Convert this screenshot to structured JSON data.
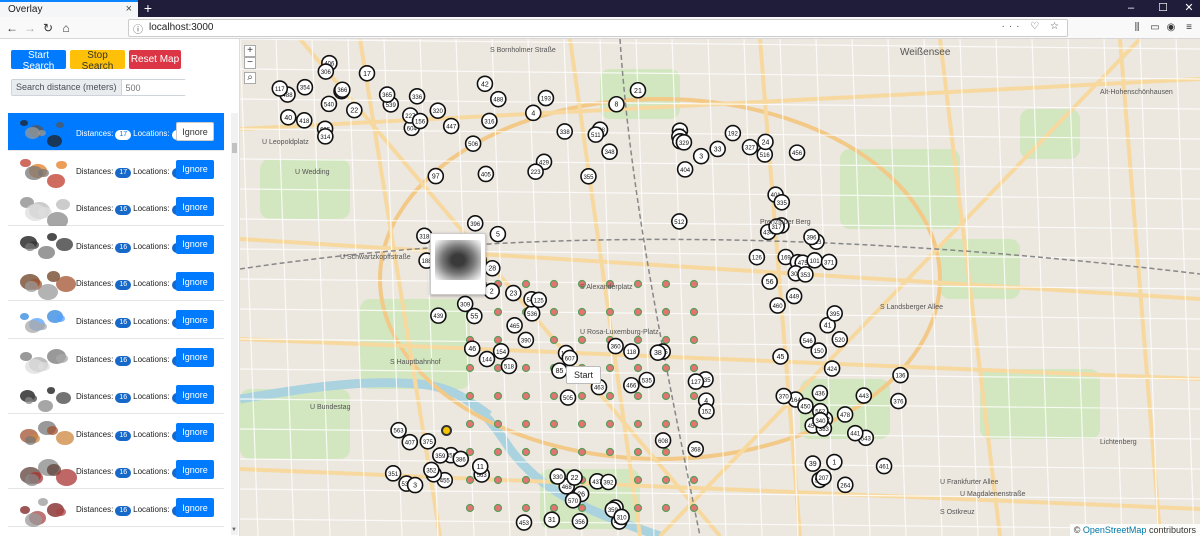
{
  "browser": {
    "tab_title": "Overlay",
    "url": "localhost:3000"
  },
  "controls": {
    "start_label": "Start Search",
    "stop_label": "Stop Search",
    "reset_label": "Reset Map",
    "distance_label": "Search distance (meters)",
    "distance_placeholder": "500"
  },
  "results": [
    {
      "distances": "17",
      "locations": "1",
      "ignore_label": "Ignore",
      "active": true
    },
    {
      "distances": "17",
      "locations": "2",
      "ignore_label": "Ignore"
    },
    {
      "distances": "16",
      "locations": "3",
      "ignore_label": "Ignore"
    },
    {
      "distances": "16",
      "locations": "3",
      "ignore_label": "Ignore"
    },
    {
      "distances": "16",
      "locations": "3",
      "ignore_label": "Ignore"
    },
    {
      "distances": "16",
      "locations": "3",
      "ignore_label": "Ignore"
    },
    {
      "distances": "16",
      "locations": "3",
      "ignore_label": "Ignore"
    },
    {
      "distances": "16",
      "locations": "3",
      "ignore_label": "Ignore"
    },
    {
      "distances": "16",
      "locations": "3",
      "ignore_label": "Ignore"
    },
    {
      "distances": "16",
      "locations": "3",
      "ignore_label": "Ignore"
    },
    {
      "distances": "16",
      "locations": "3",
      "ignore_label": "Ignore"
    }
  ],
  "row_labels": {
    "distances": "Distances:",
    "locations": "Locations:"
  },
  "map": {
    "start_label": "Start",
    "attribution_prefix": "©",
    "attribution_link": "OpenStreetMap",
    "attribution_suffix": "contributors",
    "place_names": [
      "Weißensee",
      "Alt-Hohenschönhausen",
      "U Leopoldplatz",
      "U Wedding",
      "S Bornholmer Straße",
      "U Schwartzkopffstraße",
      "S Hauptbahnhof",
      "U Bundestag",
      "S Alexanderplatz",
      "U Rosa-Luxemburg-Platz",
      "Prenzlauer Berg",
      "Lichtenberg",
      "U Frankfurter Allee",
      "S Landsberger Allee",
      "U Magdalenenstraße",
      "S Ostkreuz"
    ],
    "markers": [
      {
        "n": "540"
      },
      {
        "n": "539"
      },
      {
        "n": "528"
      },
      {
        "n": "512"
      },
      {
        "n": "454"
      },
      {
        "n": "518"
      },
      {
        "n": "535"
      },
      {
        "n": "520"
      },
      {
        "n": "513"
      },
      {
        "n": "543"
      },
      {
        "n": "563"
      },
      {
        "n": "490"
      },
      {
        "n": "488"
      },
      {
        "n": "488"
      },
      {
        "n": "511"
      },
      {
        "n": "516"
      },
      {
        "n": "439"
      },
      {
        "n": "536"
      },
      {
        "n": "535"
      },
      {
        "n": "164"
      },
      {
        "n": "169"
      },
      {
        "n": "505"
      },
      {
        "n": "530"
      },
      {
        "n": "468"
      },
      {
        "n": "398"
      },
      {
        "n": "506"
      },
      {
        "n": "193"
      },
      {
        "n": "192"
      },
      {
        "n": "188"
      },
      {
        "n": "184"
      },
      {
        "n": "435"
      },
      {
        "n": "424"
      },
      {
        "n": "449"
      },
      {
        "n": "441"
      },
      {
        "n": "407"
      },
      {
        "n": "437"
      },
      {
        "n": "418"
      },
      {
        "n": "405"
      },
      {
        "n": "404"
      },
      {
        "n": "401"
      },
      {
        "n": "396"
      },
      {
        "n": "465"
      },
      {
        "n": "463"
      },
      {
        "n": "443"
      },
      {
        "n": "460"
      },
      {
        "n": "457"
      },
      {
        "n": "458"
      },
      {
        "n": "453"
      },
      {
        "n": "605"
      },
      {
        "n": "447"
      },
      {
        "n": "429"
      },
      {
        "n": "456"
      },
      {
        "n": "318"
      },
      {
        "n": "607"
      },
      {
        "n": "608"
      },
      {
        "n": "450"
      },
      {
        "n": "434"
      },
      {
        "n": "436"
      },
      {
        "n": "455"
      },
      {
        "n": "392"
      },
      {
        "n": "406"
      },
      {
        "n": "604"
      },
      {
        "n": "4"
      },
      {
        "n": "3"
      },
      {
        "n": "5"
      },
      {
        "n": "2"
      },
      {
        "n": "38"
      },
      {
        "n": "41"
      },
      {
        "n": "42"
      },
      {
        "n": "39"
      },
      {
        "n": "37"
      },
      {
        "n": "31"
      },
      {
        "n": "22"
      },
      {
        "n": "227"
      },
      {
        "n": "223"
      },
      {
        "n": "221"
      },
      {
        "n": "67"
      },
      {
        "n": "46"
      },
      {
        "n": "466"
      },
      {
        "n": "478"
      },
      {
        "n": "475"
      },
      {
        "n": "207"
      },
      {
        "n": "386"
      },
      {
        "n": "374"
      },
      {
        "n": "314"
      },
      {
        "n": "316"
      },
      {
        "n": "348"
      },
      {
        "n": "13"
      },
      {
        "n": "55"
      },
      {
        "n": "85"
      },
      {
        "n": "118"
      },
      {
        "n": "136"
      },
      {
        "n": "101"
      },
      {
        "n": "461"
      },
      {
        "n": "359"
      },
      {
        "n": "359"
      },
      {
        "n": "117"
      },
      {
        "n": "97"
      },
      {
        "n": "21"
      },
      {
        "n": "24"
      },
      {
        "n": "61"
      },
      {
        "n": "23"
      },
      {
        "n": "4"
      },
      {
        "n": "45"
      },
      {
        "n": "56"
      },
      {
        "n": "1"
      },
      {
        "n": "3"
      },
      {
        "n": "26"
      },
      {
        "n": "17"
      },
      {
        "n": "156"
      },
      {
        "n": "158"
      },
      {
        "n": "384"
      },
      {
        "n": "564"
      },
      {
        "n": "390"
      },
      {
        "n": "360"
      },
      {
        "n": "370"
      },
      {
        "n": "306"
      },
      {
        "n": "376"
      },
      {
        "n": "375"
      },
      {
        "n": "330"
      },
      {
        "n": "40"
      },
      {
        "n": "42"
      },
      {
        "n": "8"
      },
      {
        "n": "33"
      },
      {
        "n": "28"
      },
      {
        "n": "154"
      },
      {
        "n": "368"
      },
      {
        "n": "372"
      },
      {
        "n": "371"
      },
      {
        "n": "562"
      },
      {
        "n": "351"
      },
      {
        "n": "356"
      },
      {
        "n": "354"
      },
      {
        "n": "336"
      },
      {
        "n": "329"
      },
      {
        "n": "335"
      },
      {
        "n": "534"
      },
      {
        "n": "144"
      },
      {
        "n": "152"
      },
      {
        "n": "150"
      },
      {
        "n": "353"
      },
      {
        "n": "383"
      },
      {
        "n": "563"
      },
      {
        "n": "570"
      },
      {
        "n": "366"
      },
      {
        "n": "365"
      },
      {
        "n": "355"
      },
      {
        "n": "317"
      },
      {
        "n": "309"
      },
      {
        "n": "547"
      },
      {
        "n": "127"
      },
      {
        "n": "546"
      },
      {
        "n": "126"
      },
      {
        "n": "264"
      },
      {
        "n": "11"
      },
      {
        "n": "22"
      },
      {
        "n": "306"
      },
      {
        "n": "320"
      },
      {
        "n": "338"
      },
      {
        "n": "327"
      },
      {
        "n": "551"
      },
      {
        "n": "125"
      },
      {
        "n": "505"
      },
      {
        "n": "395"
      },
      {
        "n": "396"
      },
      {
        "n": "340"
      },
      {
        "n": "352"
      },
      {
        "n": "310"
      }
    ]
  }
}
